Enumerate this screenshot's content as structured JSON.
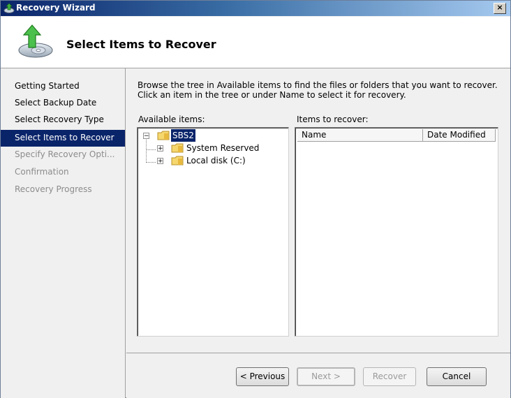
{
  "window": {
    "title": "Recovery Wizard",
    "close_label": "×"
  },
  "header": {
    "title": "Select Items to Recover"
  },
  "nav": {
    "items": [
      {
        "label": "Getting Started",
        "state": "normal"
      },
      {
        "label": "Select Backup Date",
        "state": "normal"
      },
      {
        "label": "Select Recovery Type",
        "state": "normal"
      },
      {
        "label": "Select Items to Recover",
        "state": "current"
      },
      {
        "label": "Specify Recovery Opti...",
        "state": "disabled"
      },
      {
        "label": "Confirmation",
        "state": "disabled"
      },
      {
        "label": "Recovery Progress",
        "state": "disabled"
      }
    ]
  },
  "content": {
    "instructions": "Browse the tree in Available items to find the files or folders that you want to recover. Click an item in the tree or under Name to select it for recovery.",
    "available_label": "Available items:",
    "recover_label": "Items to recover:"
  },
  "tree": {
    "root": {
      "label": "SBS2",
      "expander": "−"
    },
    "children": [
      {
        "label": "System Reserved",
        "expander": "+"
      },
      {
        "label": "Local disk (C:)",
        "expander": "+"
      }
    ]
  },
  "recover_list": {
    "columns": [
      "Name",
      "Date Modified"
    ]
  },
  "buttons": {
    "previous": "< Previous",
    "next": "Next >",
    "recover": "Recover",
    "cancel": "Cancel"
  },
  "colors": {
    "selection": "#0a246a",
    "titlebar_start": "#0a246a",
    "window_bg": "#f0f0f0"
  },
  "icons": {
    "title": "recovery-wizard-icon",
    "header": "disk-recovery-arrow-icon",
    "folder": "folder-icon"
  }
}
